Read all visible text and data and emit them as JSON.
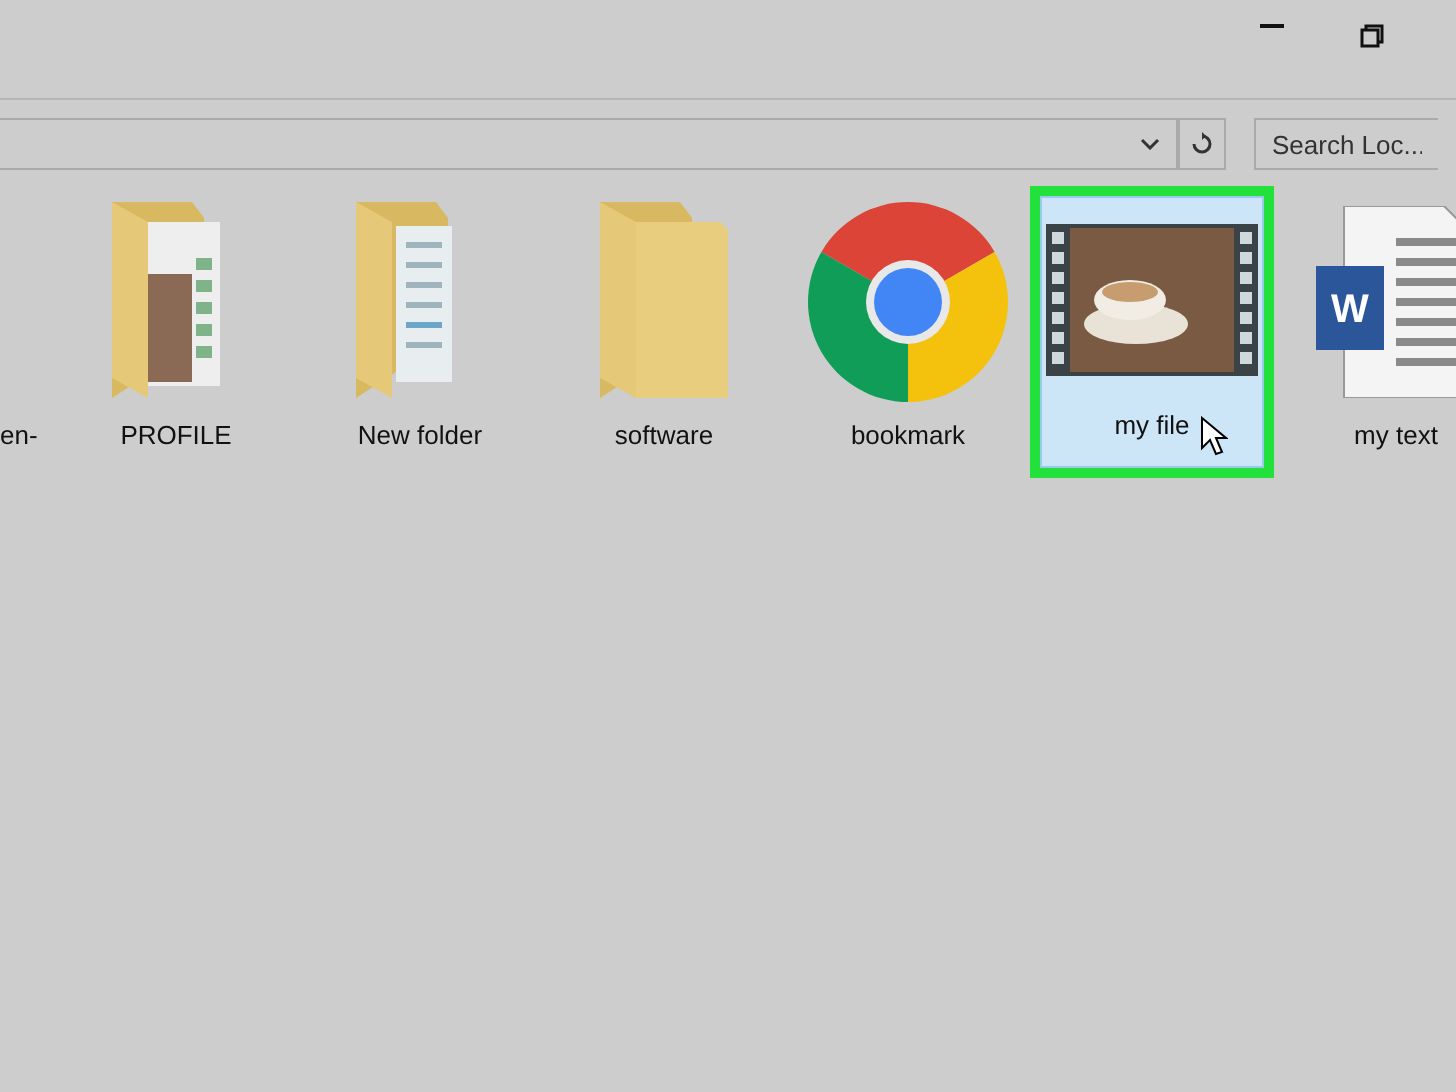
{
  "address_bar": {
    "search": {
      "placeholder": "Search Loc..."
    }
  },
  "files": [
    {
      "kind": "partial",
      "name": "en-",
      "selected": false
    },
    {
      "kind": "folder-photo",
      "name": "PROFILE",
      "selected": false
    },
    {
      "kind": "folder-docs",
      "name": "New folder",
      "selected": false
    },
    {
      "kind": "folder",
      "name": "software",
      "selected": false
    },
    {
      "kind": "chrome",
      "name": "bookmark",
      "selected": false
    },
    {
      "kind": "video",
      "name": "my file",
      "selected": true
    },
    {
      "kind": "word",
      "name": "my text",
      "selected": false,
      "badge": "W"
    }
  ]
}
